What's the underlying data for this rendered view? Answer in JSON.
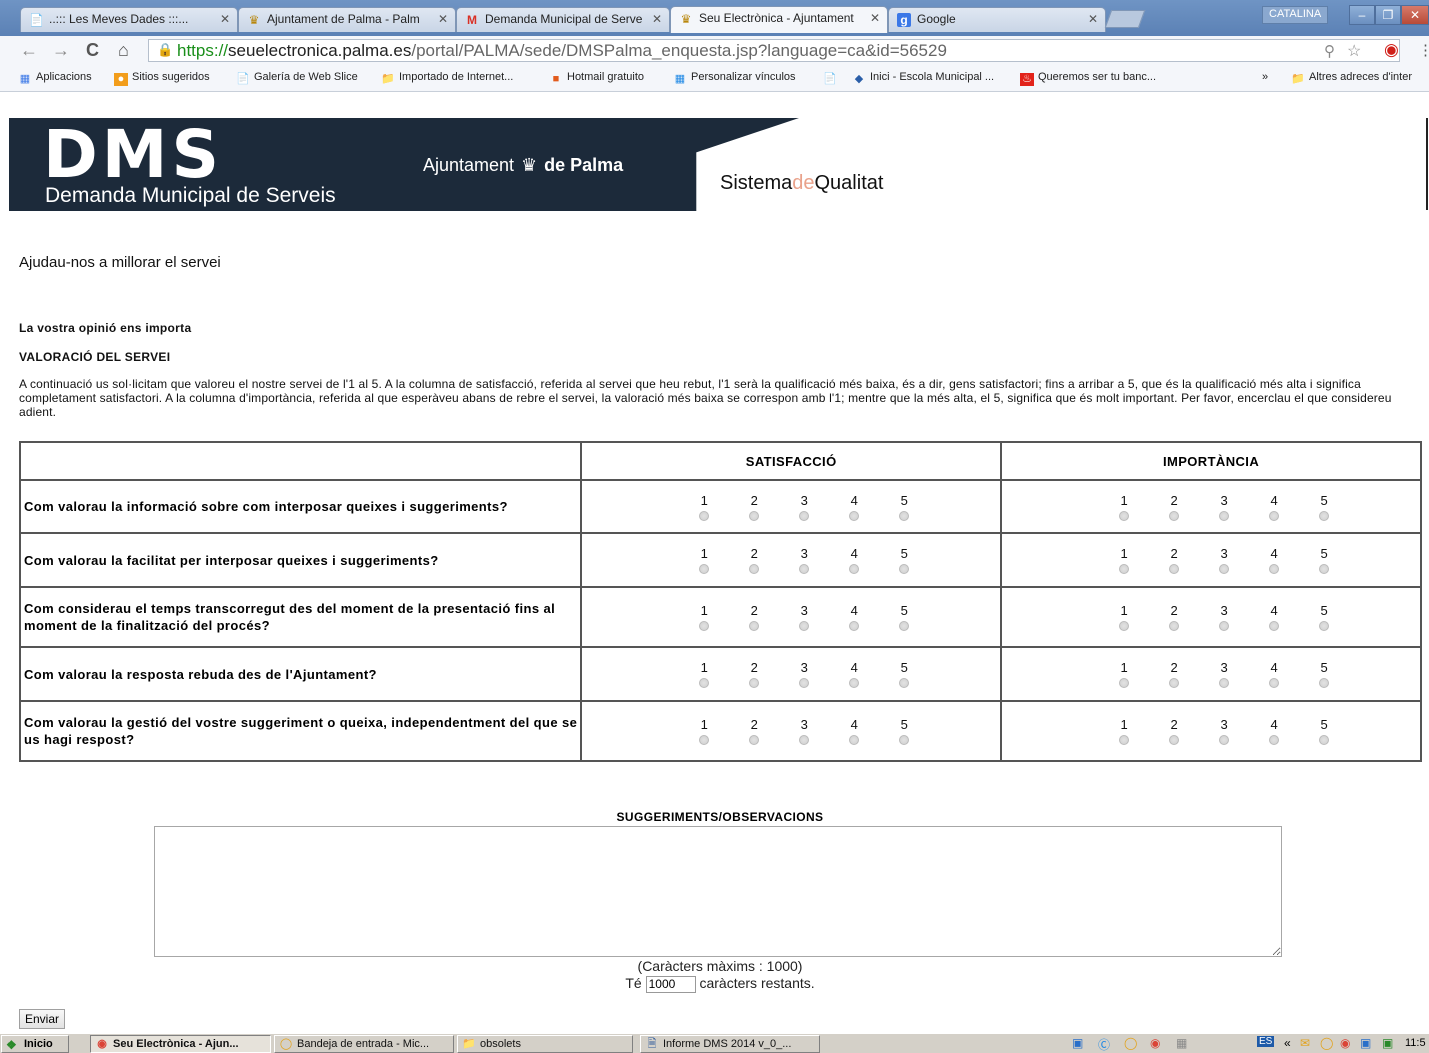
{
  "browser": {
    "tabs": [
      {
        "label": "..::: Les Meves Dades :::...",
        "icon": "page-icon"
      },
      {
        "label": "Ajuntament de Palma - Palm",
        "icon": "palma-seal-icon"
      },
      {
        "label": "Demanda Municipal de Serve",
        "icon": "gmail-icon"
      },
      {
        "label": "Seu Electrònica - Ajuntament",
        "icon": "palma-seal-icon"
      },
      {
        "label": "Google",
        "icon": "google-icon"
      }
    ],
    "user_badge": "CATALINA",
    "url": {
      "scheme": "https://",
      "host": "seuelectronica.palma.es",
      "path": "/portal/PALMA/sede/DMSPalma_enquesta.jsp?language=ca&id=56529"
    },
    "bookmarks": [
      {
        "label": "Aplicacions",
        "icon": "apps-icon"
      },
      {
        "label": "Sitios sugeridos",
        "icon": "suggested-icon"
      },
      {
        "label": "Galería de Web Slice",
        "icon": "page-icon"
      },
      {
        "label": "Importado de Internet...",
        "icon": "folder-icon"
      },
      {
        "label": "Hotmail gratuito",
        "icon": "msn-icon"
      },
      {
        "label": "Personalizar vínculos",
        "icon": "windows-icon"
      },
      {
        "label": "",
        "icon": "page-icon"
      },
      {
        "label": "Inici - Escola Municipal ...",
        "icon": "diamond-icon"
      },
      {
        "label": "Queremos ser tu banc...",
        "icon": "santander-icon"
      }
    ],
    "bookmarks_overflow": "»",
    "other_bookmarks": "Altres adreces d'inter"
  },
  "banner": {
    "logo": "DMS",
    "subtitle": "Demanda Municipal de Serveis",
    "ajuntament_prefix": "Ajuntament",
    "ajuntament_bold": "de Palma",
    "quality_a": "Sistema",
    "quality_de": "de",
    "quality_b": "Qualitat"
  },
  "page": {
    "heading": "Ajudau-nos a millorar el servei",
    "opinio": "La vostra opinió ens importa",
    "valoracio": "VALORACIÓ DEL SERVEI",
    "intro": "A continuació us sol·licitam que valoreu el nostre servei de l'1 al 5. A la columna de satisfacció, referida al servei que heu rebut, l'1 serà la qualificació més baixa, és a dir, gens satisfactori; fins a arribar a 5, que és la qualificació més alta i significa completament satisfactori. A la columna d'importància, referida al que esperàveu abans de rebre el servei, la valoració més baixa se correspon amb l'1; mentre que la més alta, el 5, significa que és molt important. Per favor, encerclau el que considereu adient."
  },
  "survey": {
    "col_satisfaccio": "SATISFACCIÓ",
    "col_importancia": "IMPORTÀNCIA",
    "scale": [
      "1",
      "2",
      "3",
      "4",
      "5"
    ],
    "questions": [
      "Com valorau la informació sobre com interposar queixes i suggeriments?",
      "Com valorau la facilitat per interposar queixes i suggeriments?",
      "Com considerau el temps transcorregut des del moment de la presentació fins al moment de la finalització del procés?",
      "Com valorau la resposta rebuda des de l'Ajuntament?",
      "Com valorau la gestió del vostre suggeriment o queixa, independentment del que se us hagi respost?"
    ]
  },
  "suggestions": {
    "label": "SUGGERIMENTS/OBSERVACIONS",
    "value": "",
    "max_chars_text": "(Caràcters màxims : 1000)",
    "remaining_prefix": "Té",
    "remaining_value": "1000",
    "remaining_suffix": "caràcters restants."
  },
  "send_button": "Enviar",
  "taskbar": {
    "start": "Inicio",
    "items": [
      {
        "label": "Seu Electrònica - Ajun...",
        "icon": "chrome-icon",
        "active": true
      },
      {
        "label": "Bandeja de entrada - Mic...",
        "icon": "outlook-icon",
        "active": false
      },
      {
        "label": "obsolets",
        "icon": "folder-icon",
        "active": false
      },
      {
        "label": "Informe DMS 2014 v_0_...",
        "icon": "word-icon",
        "active": false
      }
    ],
    "language": "ES",
    "clock": "11:5"
  }
}
